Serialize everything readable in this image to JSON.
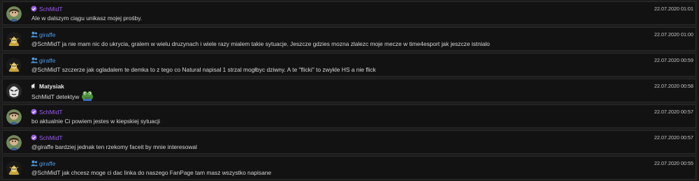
{
  "messages": [
    {
      "author": "SchMidT",
      "role": "purple",
      "avatar": "schmidt-avatar",
      "text": "Ale w dalszym ciągu unikasz mojej prośby.",
      "time": "22.07.2020 01:01"
    },
    {
      "author": "giraffe",
      "role": "blue",
      "avatar": "giraffe-avatar",
      "text": "@SchMidT ja nie mam nic do ukrycia, gralem w wielu druzynach i wiele razy mialem takie sytuacje. Jeszcze gdzies mozna zlalezc moje mecze w time4esport jak jeszcze istnialo",
      "time": "22.07.2020 01:00"
    },
    {
      "author": "giraffe",
      "role": "blue",
      "avatar": "giraffe-avatar",
      "text": "@SchMidT szczerze jak ogladalem te demka to z tego co Natural napisal 1 strzal mogłbyc dziwny. A te \"flicki\" to zwykle HS a nie flick",
      "time": "22.07.2020 00:59"
    },
    {
      "author": "Matysiak",
      "role": "white",
      "avatar": "matysiak-avatar",
      "text": "SchMidT detektyw",
      "emote": "frog-emote",
      "time": "22.07.2020 00:58"
    },
    {
      "author": "SchMidT",
      "role": "purple",
      "avatar": "schmidt-avatar",
      "text": "bo aktualnie Ci powiem jestes w kiepskiej sytuacji",
      "time": "22.07.2020 00:57"
    },
    {
      "author": "SchMidT",
      "role": "purple",
      "avatar": "schmidt-avatar",
      "text": "@giraffe bardziej jednak ten rzekomy faceit by mnie interesowal",
      "time": "22.07.2020 00:57"
    },
    {
      "author": "giraffe",
      "role": "blue",
      "avatar": "giraffe-avatar",
      "text": "@SchMidT jak chcesz moge ci dac linka do naszego FanPage tam masz wszystko napisane",
      "time": "22.07.2020 00:55"
    }
  ],
  "colors": {
    "purple": "#9b5cf0",
    "blue": "#4a9be8",
    "background": "#121212"
  }
}
